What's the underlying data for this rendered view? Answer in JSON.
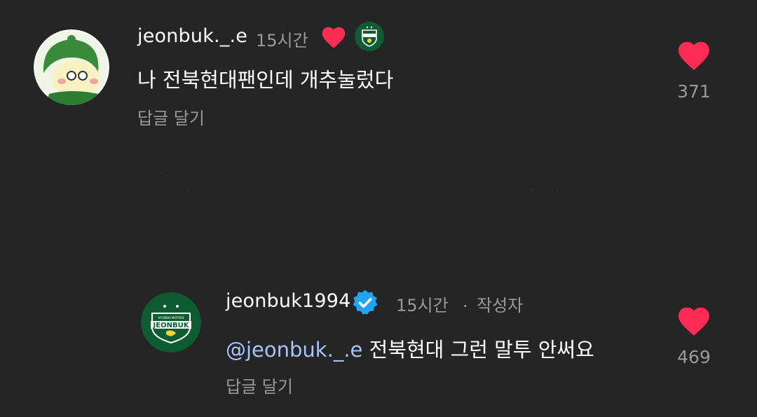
{
  "colors": {
    "background": "#252525",
    "text_primary": "#ffffff",
    "text_secondary": "#9a9a9a",
    "mention": "#a8c4ff",
    "heart": "#fe2c55",
    "verified": "#20a4f3",
    "club_green": "#0f5c33"
  },
  "comments": [
    {
      "username": "jeonbuk._.e",
      "time": "15시간",
      "liked_by_author_icon": "heart-icon",
      "author_avatar_icon": "jeonbuk-crest-icon",
      "text": "나 전북현대팬인데 개추눌렀다",
      "reply_label": "답글 달기",
      "like_icon": "heart-icon",
      "like_count": "371"
    }
  ],
  "reply": {
    "username": "jeonbuk1994",
    "verified_icon": "verified-badge-icon",
    "time": "15시간",
    "separator": ".",
    "author_label": "작성자",
    "mention": "@jeonbuk._.e",
    "text": " 전북현대 그런 말투 안써요",
    "reply_label": "답글 달기",
    "like_icon": "heart-icon",
    "like_count": "469",
    "crest_text": "JEONBUK",
    "crest_subtext": "HYUNDAI MOTORS"
  }
}
